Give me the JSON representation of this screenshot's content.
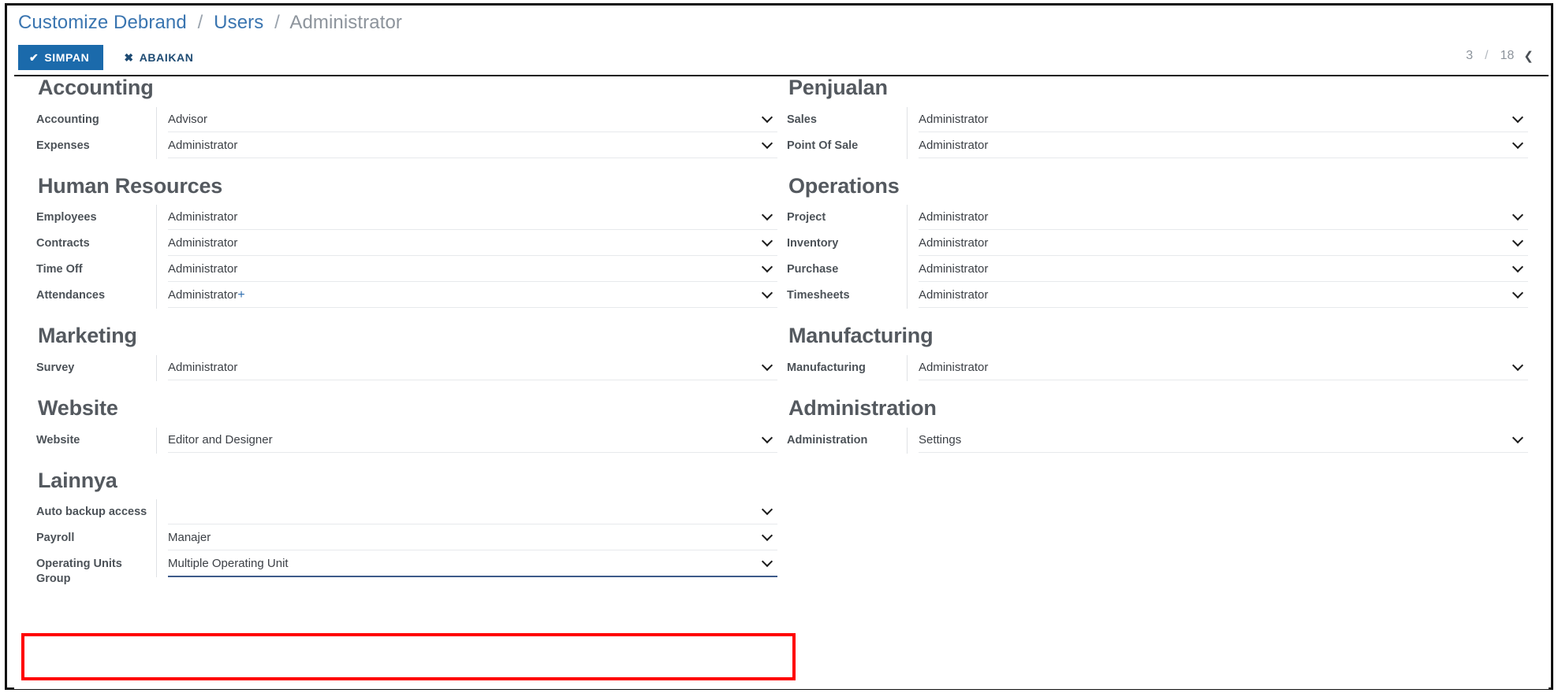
{
  "breadcrumb": {
    "items": [
      {
        "label": "Customize Debrand",
        "type": "link"
      },
      {
        "label": "Users",
        "type": "link"
      },
      {
        "label": "Administrator",
        "type": "current"
      }
    ],
    "separator": "/"
  },
  "toolbar": {
    "save_label": "SIMPAN",
    "save_icon": "check-icon",
    "discard_label": "ABAIKAN",
    "discard_icon": "close-icon",
    "save_color": "#1b6aab"
  },
  "pager": {
    "current": "3",
    "separator": "/",
    "total": "18",
    "prev_icon": "chevron-left-icon"
  },
  "columns": {
    "left": [
      {
        "title": "Accounting",
        "rows": [
          {
            "label": "Accounting",
            "value": "Advisor"
          },
          {
            "label": "Expenses",
            "value": "Administrator"
          }
        ]
      },
      {
        "title": "Human Resources",
        "rows": [
          {
            "label": "Employees",
            "value": "Administrator"
          },
          {
            "label": "Contracts",
            "value": "Administrator"
          },
          {
            "label": "Time Off",
            "value": "Administrator"
          },
          {
            "label": "Attendances",
            "value": "Administrator",
            "suffix": "+"
          }
        ]
      },
      {
        "title": "Marketing",
        "rows": [
          {
            "label": "Survey",
            "value": "Administrator"
          }
        ]
      },
      {
        "title": "Website",
        "rows": [
          {
            "label": "Website",
            "value": "Editor and Designer"
          }
        ]
      },
      {
        "title": "Lainnya",
        "rows": [
          {
            "label": "Auto backup access",
            "value": ""
          },
          {
            "label": "Payroll",
            "value": "Manajer"
          },
          {
            "label": "Operating Units Group",
            "value": "Multiple Operating Unit",
            "focused": true
          }
        ]
      }
    ],
    "right": [
      {
        "title": "Penjualan",
        "rows": [
          {
            "label": "Sales",
            "value": "Administrator"
          },
          {
            "label": "Point Of Sale",
            "value": "Administrator"
          }
        ]
      },
      {
        "title": "Operations",
        "rows": [
          {
            "label": "Project",
            "value": "Administrator"
          },
          {
            "label": "Inventory",
            "value": "Administrator"
          },
          {
            "label": "Purchase",
            "value": "Administrator"
          },
          {
            "label": "Timesheets",
            "value": "Administrator"
          }
        ]
      },
      {
        "title": "Manufacturing",
        "rows": [
          {
            "label": "Manufacturing",
            "value": "Administrator"
          }
        ]
      },
      {
        "title": "Administration",
        "rows": [
          {
            "label": "Administration",
            "value": "Settings"
          }
        ]
      }
    ]
  },
  "annotation": {
    "highlight_color": "#ff0000",
    "target": "Operating Units Group"
  }
}
